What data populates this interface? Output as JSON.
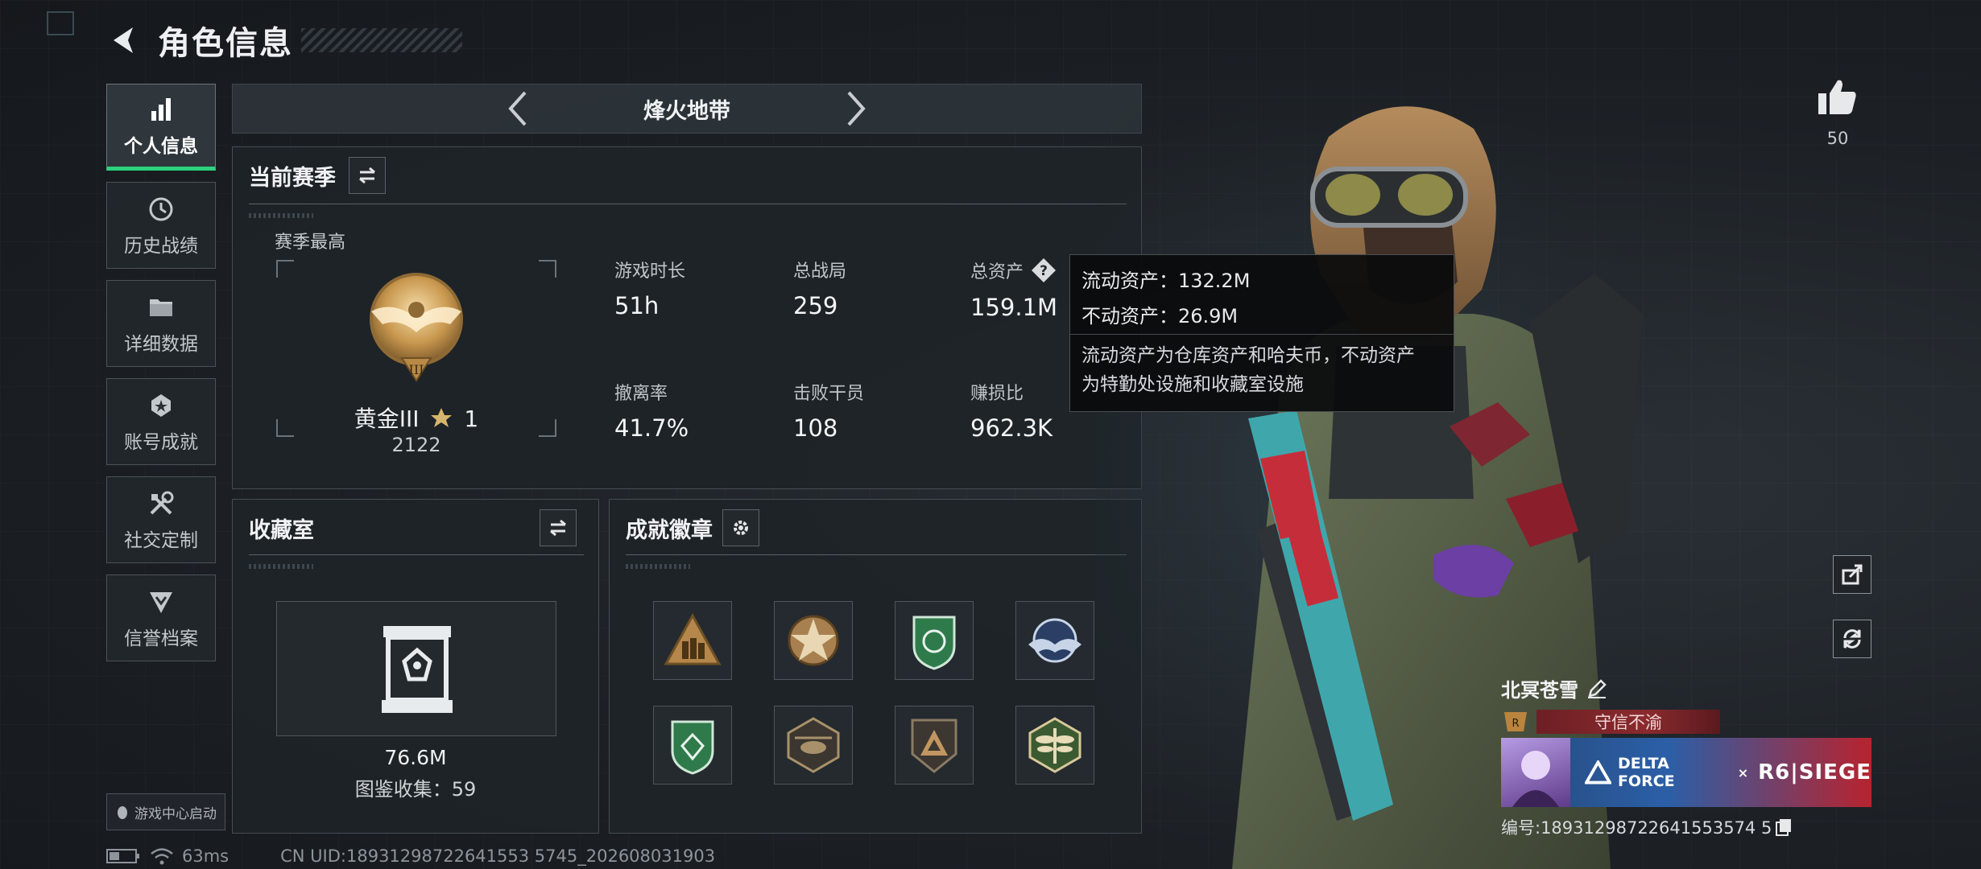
{
  "header": {
    "title": "角色信息"
  },
  "nav": {
    "items": [
      {
        "label": "个人信息",
        "icon": "bar-chart-icon",
        "active": true
      },
      {
        "label": "历史战绩",
        "icon": "history-icon"
      },
      {
        "label": "详细数据",
        "icon": "folder-icon"
      },
      {
        "label": "账号成就",
        "icon": "achievement-icon"
      },
      {
        "label": "社交定制",
        "icon": "tools-icon"
      },
      {
        "label": "信誉档案",
        "icon": "reputation-icon"
      }
    ],
    "launch_label": "游戏中心启动"
  },
  "mode": {
    "title": "烽火地带"
  },
  "season": {
    "title": "当前赛季",
    "subtitle": "赛季最高",
    "rank_name": "黄金III",
    "rank_stars": "1",
    "rank_score": "2122",
    "stats": [
      {
        "label": "游戏时长",
        "value": "51h"
      },
      {
        "label": "总战局",
        "value": "259"
      },
      {
        "label": "总资产",
        "value": "159.1M"
      },
      {
        "label": "撤离率",
        "value": "41.7%"
      },
      {
        "label": "击败干员",
        "value": "108"
      },
      {
        "label": "赚损比",
        "value": "962.3K"
      }
    ]
  },
  "tooltip": {
    "line1": "流动资产：132.2M",
    "line2": "不动资产：26.9M",
    "desc_line1": "流动资产为仓库资产和哈夫币，不动资产",
    "desc_line2": "为特勤处设施和收藏室设施"
  },
  "collection": {
    "title": "收藏室",
    "value": "76.6M",
    "count": "图鉴收集：59"
  },
  "badges": {
    "title": "成就徽章",
    "items": [
      "triangle-soldiers-badge",
      "star-badge",
      "green-shield-badge",
      "winged-emblem-badge",
      "green-shield-diamond-badge",
      "helicopter-badge",
      "pyramid-badge",
      "dragonfly-badge"
    ]
  },
  "status": {
    "ping": "63ms",
    "uid_text": "CN UID:18931298722641553 5745_202608031903"
  },
  "likes": {
    "count": "50"
  },
  "player": {
    "name": "北冥苍雪",
    "reputation": "守信不渝",
    "banner_brand1": "DELTA FORCE",
    "banner_x": "×",
    "banner_brand2": "R6|SIEGE",
    "id_text": "编号:18931298722641553574 5"
  },
  "colors": {
    "accent_green": "#2cd27d",
    "reputation_red": "#8a2a2e"
  }
}
